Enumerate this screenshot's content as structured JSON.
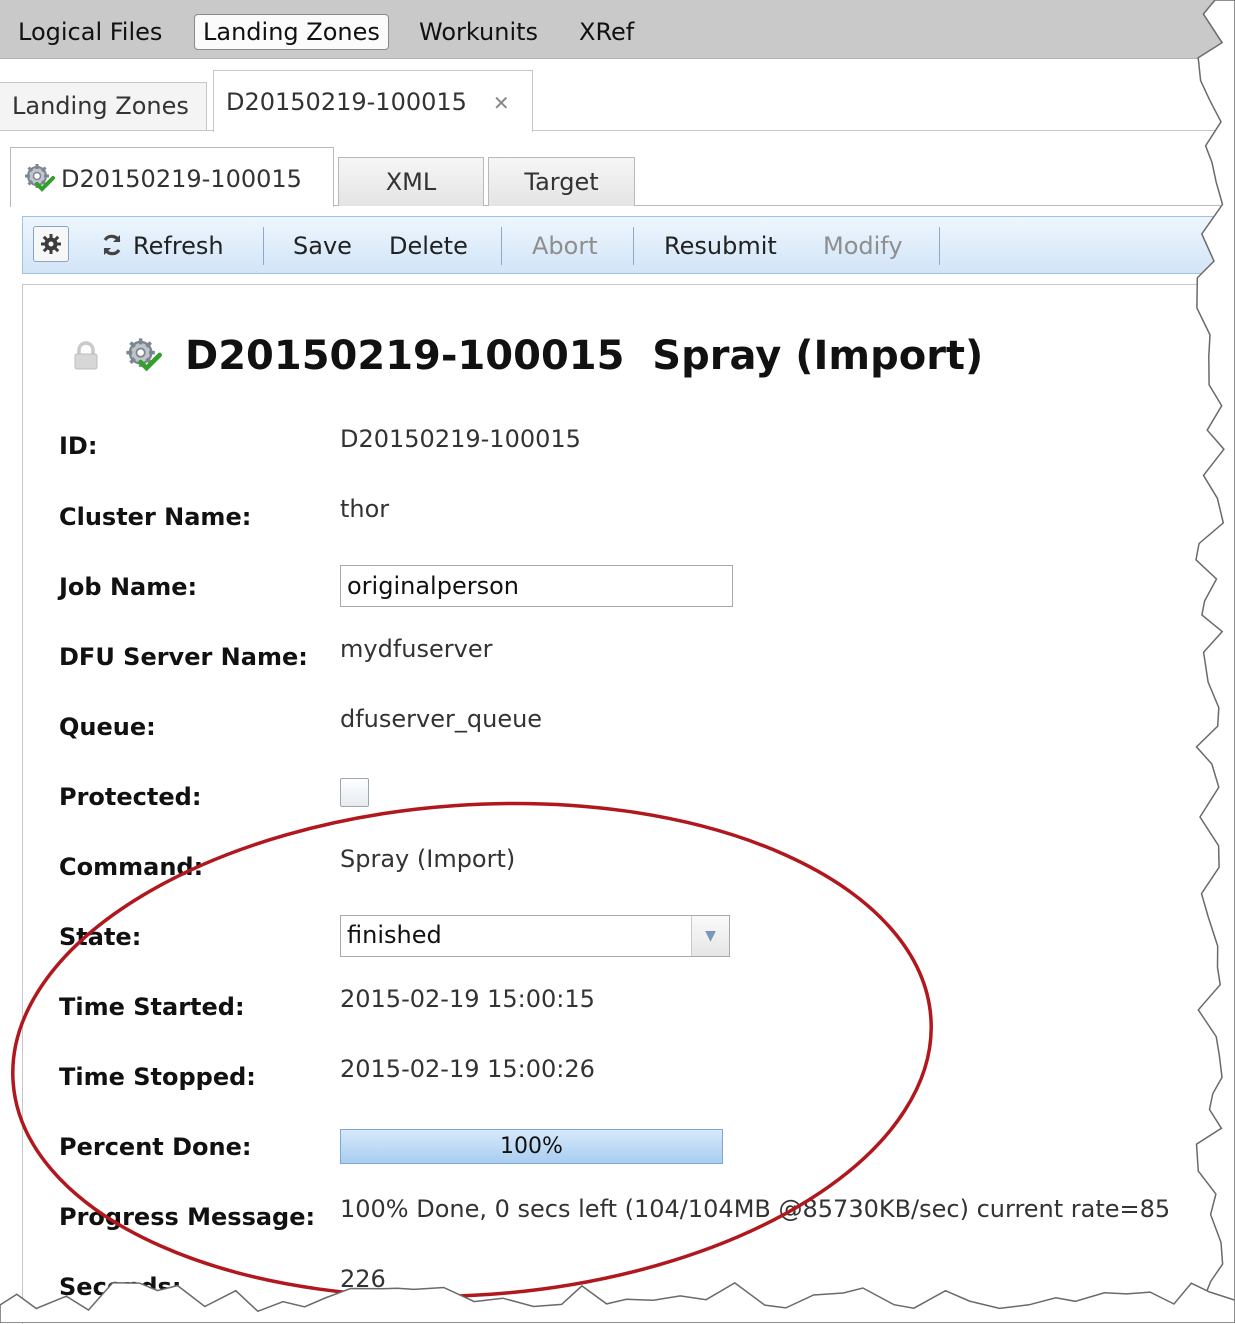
{
  "top_nav": {
    "items": [
      {
        "label": "Logical Files",
        "active": false
      },
      {
        "label": "Landing Zones",
        "active": true
      },
      {
        "label": "Workunits",
        "active": false
      },
      {
        "label": "XRef",
        "active": false
      }
    ]
  },
  "tabs_level1": [
    {
      "label": "Landing Zones",
      "active": false
    },
    {
      "label": "D20150219-100015",
      "active": true,
      "close_icon": "close-icon"
    }
  ],
  "tabs_level2": [
    {
      "label": "D20150219-100015",
      "active": true,
      "icon": "gear-check-icon"
    },
    {
      "label": "XML",
      "active": false
    },
    {
      "label": "Target",
      "active": false
    }
  ],
  "toolbar": {
    "refresh": "Refresh",
    "save": "Save",
    "delete": "Delete",
    "abort": "Abort",
    "resubmit": "Resubmit",
    "modify": "Modify"
  },
  "header": {
    "title": "D20150219-100015  Spray (Import)",
    "icons": [
      "lock-icon",
      "gear-check-icon"
    ]
  },
  "fields": {
    "id": {
      "label": "ID:",
      "value": "D20150219-100015"
    },
    "cluster": {
      "label": "Cluster Name:",
      "value": "thor"
    },
    "job_name": {
      "label": "Job Name:",
      "value": "originalperson"
    },
    "dfu_server": {
      "label": "DFU Server Name:",
      "value": "mydfuserver"
    },
    "queue": {
      "label": "Queue:",
      "value": "dfuserver_queue"
    },
    "protected": {
      "label": "Protected:",
      "checked": false
    },
    "command": {
      "label": "Command:",
      "value": "Spray (Import)"
    },
    "state": {
      "label": "State:",
      "value": "finished"
    },
    "time_started": {
      "label": "Time Started:",
      "value": "2015-02-19 15:00:15"
    },
    "time_stopped": {
      "label": "Time Stopped:",
      "value": "2015-02-19 15:00:26"
    },
    "percent_done": {
      "label": "Percent Done:",
      "value": "100%",
      "fraction": 1.0
    },
    "progress_message": {
      "label": "Progress Message:",
      "value": "100% Done, 0 secs left (104/104MB @85730KB/sec) current rate=85"
    },
    "seconds": {
      "label": "Seconds:",
      "value": "226"
    }
  },
  "colors": {
    "annotation_ellipse": "#b0181e",
    "toolbar_bg": "#dbeaf9",
    "progress_fill": "#b5d5f3"
  }
}
